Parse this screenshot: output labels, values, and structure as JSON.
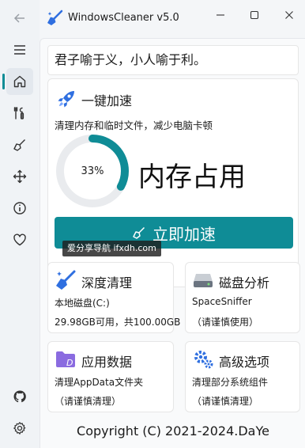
{
  "app": {
    "title": "WindowsCleaner v5.0"
  },
  "sidebar": {
    "items": [
      {
        "name": "back",
        "icon": "back-arrow-icon"
      },
      {
        "name": "menu",
        "icon": "hamburger-menu-icon"
      },
      {
        "name": "home",
        "icon": "home-icon",
        "active": true
      },
      {
        "name": "tools",
        "icon": "tools-icon"
      },
      {
        "name": "clean",
        "icon": "broom-icon"
      },
      {
        "name": "move",
        "icon": "move-arrows-icon"
      },
      {
        "name": "info",
        "icon": "info-icon"
      },
      {
        "name": "favorite",
        "icon": "heart-icon"
      },
      {
        "name": "github",
        "icon": "github-icon"
      },
      {
        "name": "settings",
        "icon": "gear-icon"
      }
    ]
  },
  "quote": "君子喻于义，小人喻于利。",
  "boost": {
    "title": "一键加速",
    "description": "清理内存和临时文件，减少电脑卡顿",
    "memory_percent": 33,
    "memory_percent_text": "33%",
    "memory_label": "内存占用",
    "button_label": "立即加速"
  },
  "watermark": "爱分享导航 ifxdh.com",
  "tiles": {
    "deep_clean": {
      "title": "深度清理",
      "line1": "本地磁盘(C:)",
      "line2": "29.98GB可用，共100.00GB"
    },
    "disk_analysis": {
      "title": "磁盘分析",
      "line1": "SpaceSniffer",
      "line2": "（请谨慎使用）"
    },
    "app_data": {
      "title": "应用数据",
      "line1": "清理AppData文件夹",
      "line2": "（请谨慎清理）"
    },
    "advanced": {
      "title": "高级选项",
      "line1": "清理部分系统组件",
      "line2": "（请谨慎清理）"
    }
  },
  "footer": {
    "copyright": "Copyright (C) 2021-2024.DaYe"
  },
  "colors": {
    "accent": "#0f8c96",
    "gauge_track": "#e9ebee",
    "icon_blue": "#2f6fe0",
    "icon_purple": "#8a6be0"
  }
}
